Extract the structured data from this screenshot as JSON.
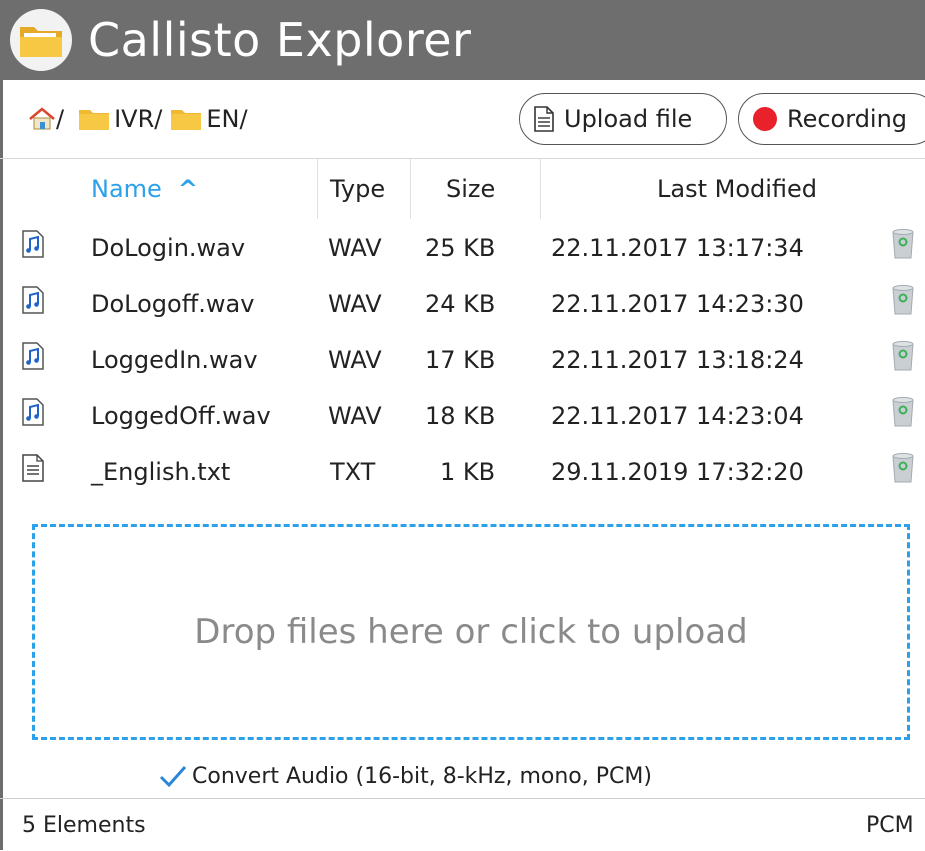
{
  "app": {
    "title": "Callisto Explorer",
    "logo_icon": "folder-logo-icon"
  },
  "breadcrumb": {
    "home_icon": "home-icon",
    "home_sep": "/",
    "items": [
      {
        "label": "IVR/",
        "icon": "folder-icon"
      },
      {
        "label": "EN/",
        "icon": "folder-icon"
      }
    ]
  },
  "toolbar": {
    "upload_label": "Upload file",
    "upload_icon": "document-icon",
    "record_label": "Recording",
    "record_icon": "record-dot-icon"
  },
  "table": {
    "columns": {
      "name": "Name",
      "type": "Type",
      "size": "Size",
      "modified": "Last Modified"
    },
    "sort_indicator": "^",
    "rows": [
      {
        "icon": "audio-file-icon",
        "name": "DoLogin.wav",
        "type": "WAV",
        "size": "25 KB",
        "modified": "22.11.2017 13:17:34"
      },
      {
        "icon": "audio-file-icon",
        "name": "DoLogoff.wav",
        "type": "WAV",
        "size": "24 KB",
        "modified": "22.11.2017 14:23:30"
      },
      {
        "icon": "audio-file-icon",
        "name": "LoggedIn.wav",
        "type": "WAV",
        "size": "17 KB",
        "modified": "22.11.2017 13:18:24"
      },
      {
        "icon": "audio-file-icon",
        "name": "LoggedOff.wav",
        "type": "WAV",
        "size": "18 KB",
        "modified": "22.11.2017 14:23:04"
      },
      {
        "icon": "text-file-icon",
        "name": "_English.txt",
        "type": "TXT",
        "size": "1 KB",
        "modified": "29.11.2019 17:32:20"
      }
    ]
  },
  "dropzone": {
    "text": "Drop files here or click to upload"
  },
  "convert": {
    "checked": true,
    "label": "Convert Audio (16-bit, 8-kHz, mono, PCM)"
  },
  "status": {
    "count": "5 Elements",
    "format": "PCM"
  },
  "colors": {
    "titlebar": "#6e6e6e",
    "accent": "#2aa1e8",
    "record": "#e8212b",
    "folder": "#f7c844"
  }
}
